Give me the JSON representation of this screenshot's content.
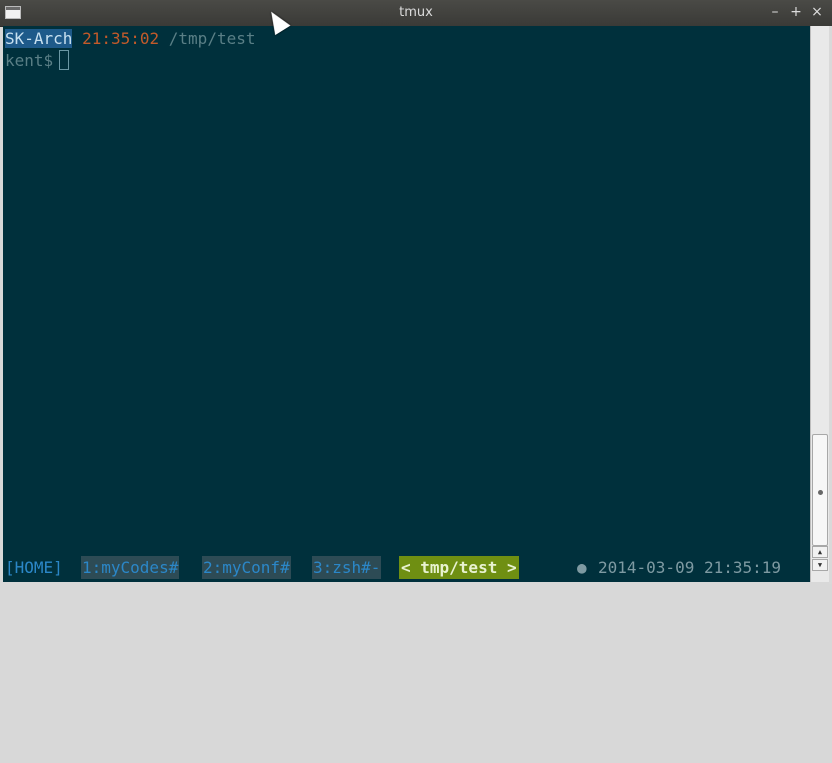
{
  "window": {
    "title": "tmux",
    "controls": {
      "minimize": "–",
      "maximize": "+",
      "close": "×"
    }
  },
  "terminal": {
    "prompt_line": {
      "host": "SK-Arch",
      "time": "21:35:02",
      "path": "/tmp/test"
    },
    "user_prompt": "kent$"
  },
  "tmux_status": {
    "session": "[HOME]",
    "windows": [
      {
        "label": "1:myCodes#"
      },
      {
        "label": "2:myConf#"
      },
      {
        "label": "3:zsh#-"
      }
    ],
    "active_window": "< tmp/test >",
    "indicator": "●",
    "clock": "2014-03-09 21:35:19"
  },
  "scrollbar": {
    "up_arrow": "▲",
    "down_arrow": "▼"
  },
  "colors": {
    "terminal_bg": "#00303c",
    "host_highlight": "#1e5a8a",
    "time": "#c25a2a",
    "active_tab": "#6f8f12",
    "status_blue": "#2b87c8"
  }
}
